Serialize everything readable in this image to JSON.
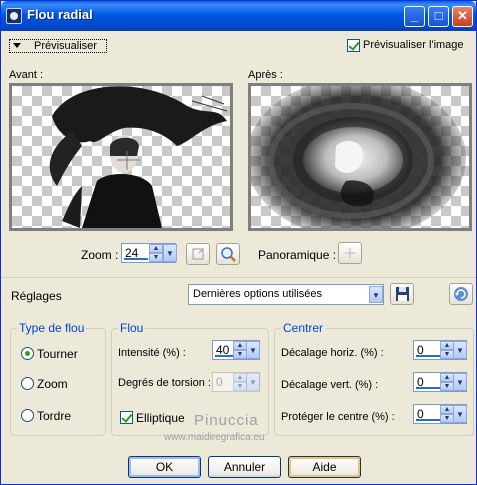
{
  "window": {
    "title": "Flou radial"
  },
  "titlebar_buttons": {
    "minimize": "_",
    "maximize": "□",
    "close": "✕"
  },
  "preview": {
    "toggle_label": "Prévisualiser",
    "image_checkbox_label": "Prévisualiser l'image",
    "image_checked": true,
    "before_label": "Avant :",
    "after_label": "Après :"
  },
  "zoom": {
    "label": "Zoom :",
    "value": "24"
  },
  "pan": {
    "label": "Panoramique :"
  },
  "settings": {
    "label": "Réglages",
    "preset_value": "Dernières options utilisées"
  },
  "blur_type": {
    "title": "Type de flou",
    "options": [
      "Tourner",
      "Zoom",
      "Tordre"
    ],
    "selected": "Tourner"
  },
  "blur": {
    "title": "Flou",
    "intensity_label": "Intensité (%) :",
    "intensity_value": "40",
    "torsion_label": "Degrés de torsion :",
    "torsion_value": "0",
    "elliptic_label": "Elliptique",
    "elliptic_checked": true
  },
  "center": {
    "title": "Centrer",
    "h_offset_label": "Décalage horiz. (%) :",
    "h_offset_value": "0",
    "v_offset_label": "Décalage vert. (%) :",
    "v_offset_value": "0",
    "protect_label": "Protéger le centre (%) :",
    "protect_value": "0"
  },
  "watermark": {
    "name": "Pinuccia",
    "site": "www.maidiregrafica.eu"
  },
  "buttons": {
    "ok": "OK",
    "cancel": "Annuler",
    "help": "Aide"
  },
  "colors": {
    "titlebar": "#0058e6",
    "group_title": "#0046d5",
    "face": "#ece9d8"
  }
}
